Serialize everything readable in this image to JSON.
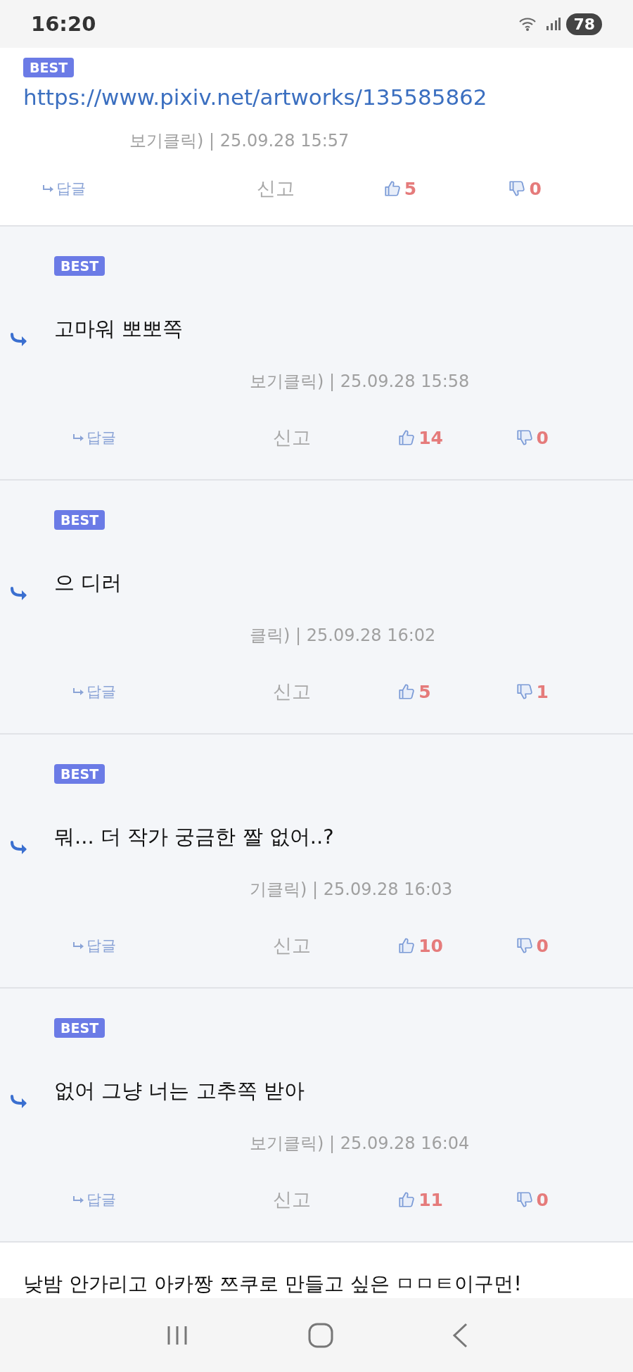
{
  "status_bar": {
    "time": "16:20",
    "battery": "78"
  },
  "comments": [
    {
      "kind": "comment",
      "best": true,
      "badge": "BEST",
      "link": "https://www.pixiv.net/artworks/135585862",
      "meta": "보기클릭) | 25.09.28 15:57",
      "reply": "답글",
      "report": "신고",
      "likes": "5",
      "dislikes": "0"
    },
    {
      "kind": "reply",
      "best": true,
      "badge": "BEST",
      "text": "고마워 뽀뽀쪽",
      "meta": "보기클릭) | 25.09.28 15:58",
      "reply": "답글",
      "report": "신고",
      "likes": "14",
      "dislikes": "0"
    },
    {
      "kind": "reply",
      "best": true,
      "badge": "BEST",
      "text": "으 디러",
      "meta": "클릭) | 25.09.28 16:02",
      "reply": "답글",
      "report": "신고",
      "likes": "5",
      "dislikes": "1"
    },
    {
      "kind": "reply",
      "best": true,
      "badge": "BEST",
      "text": "뭐... 더 작가 궁금한 짤 없어..?",
      "meta": "기클릭) | 25.09.28 16:03",
      "reply": "답글",
      "report": "신고",
      "likes": "10",
      "dislikes": "0"
    },
    {
      "kind": "reply",
      "best": true,
      "badge": "BEST",
      "text": "없어 그냥 너는 고추쪽 받아",
      "meta": "보기클릭) | 25.09.28 16:04",
      "reply": "답글",
      "report": "신고",
      "likes": "11",
      "dislikes": "0"
    }
  ],
  "next_comment": {
    "text": "낮밤 안가리고 아카짱 쯔쿠로 만들고 싶은 ㅁㅁㅌ이구먼!"
  }
}
